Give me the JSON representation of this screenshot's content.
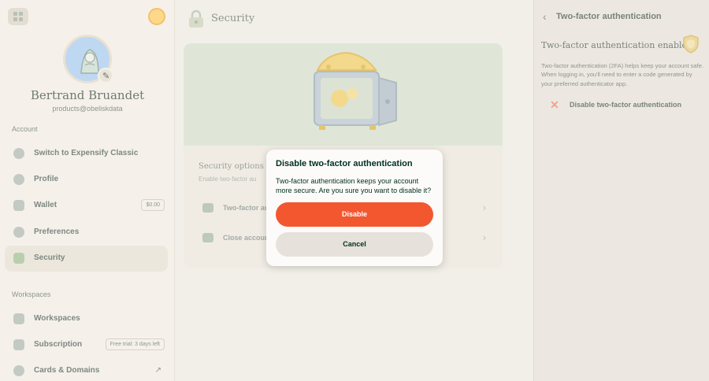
{
  "colors": {
    "danger": "#f25730",
    "text_primary": "#002e22",
    "hero_bg": "#dfe6d7",
    "page_bg": "#f2efe9"
  },
  "user": {
    "name": "Bertrand Bruandet",
    "email": "products@obeliskdata"
  },
  "sidebar": {
    "account_label": "Account",
    "workspaces_label": "Workspaces",
    "items": [
      {
        "label": "Switch to Expensify Classic",
        "icon": "switch-icon"
      },
      {
        "label": "Profile",
        "icon": "profile-icon"
      },
      {
        "label": "Wallet",
        "icon": "wallet-icon",
        "badge": "$0.00"
      },
      {
        "label": "Preferences",
        "icon": "gear-icon"
      },
      {
        "label": "Security",
        "icon": "lock-icon",
        "active": true
      }
    ],
    "workspace_items": [
      {
        "label": "Workspaces",
        "icon": "building-icon"
      },
      {
        "label": "Subscription",
        "icon": "card-icon",
        "badge": "Free trial: 3 days left"
      },
      {
        "label": "Cards & Domains",
        "icon": "globe-icon"
      }
    ]
  },
  "main": {
    "title": "Security",
    "card": {
      "title": "Security options",
      "subtitle": "Enable two-factor au",
      "options": [
        {
          "label": "Two-factor au",
          "icon": "shield-icon"
        },
        {
          "label": "Close accoun",
          "icon": "close-account-icon"
        }
      ]
    }
  },
  "right_panel": {
    "title": "Two-factor authentication",
    "heading": "Two-factor authentication enabled",
    "description": "Two-factor authentication (2FA) helps keep your account safe. When logging in, you'll need to enter a code generated by your preferred authenticator app.",
    "action_label": "Disable two-factor authentication"
  },
  "modal": {
    "title": "Disable two-factor authentication",
    "body": "Two-factor authentication keeps your account more secure. Are you sure you want to disable it?",
    "confirm_label": "Disable",
    "cancel_label": "Cancel"
  }
}
